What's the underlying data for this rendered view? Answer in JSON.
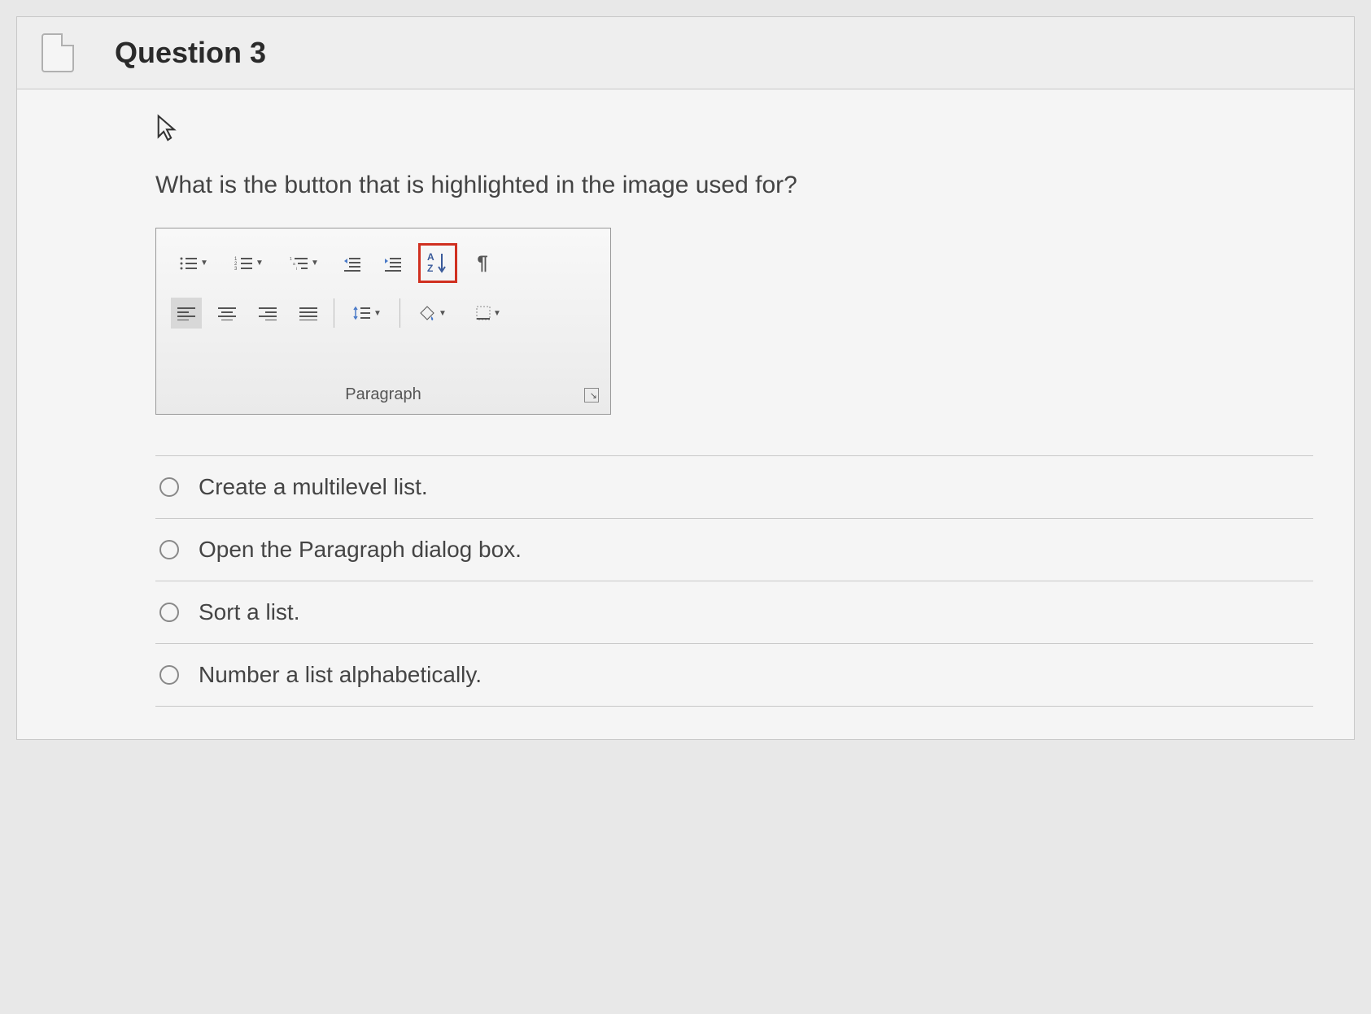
{
  "header": {
    "title": "Question 3"
  },
  "prompt": "What is the button that is highlighted in the image used for?",
  "ribbon": {
    "group_label": "Paragraph",
    "buttons": {
      "bullets": "Bullets",
      "numbering": "Numbering",
      "multilevel": "Multilevel List",
      "decrease_indent": "Decrease Indent",
      "increase_indent": "Increase Indent",
      "sort": "Sort",
      "show_hide": "Show/Hide ¶",
      "align_left": "Align Left",
      "align_center": "Center",
      "align_right": "Align Right",
      "justify": "Justify",
      "line_spacing": "Line Spacing",
      "shading": "Shading",
      "borders": "Borders"
    },
    "highlighted_button": "sort"
  },
  "answers": [
    {
      "text": "Create a multilevel list."
    },
    {
      "text": "Open the Paragraph dialog box."
    },
    {
      "text": "Sort a list."
    },
    {
      "text": "Number a list alphabetically."
    }
  ]
}
